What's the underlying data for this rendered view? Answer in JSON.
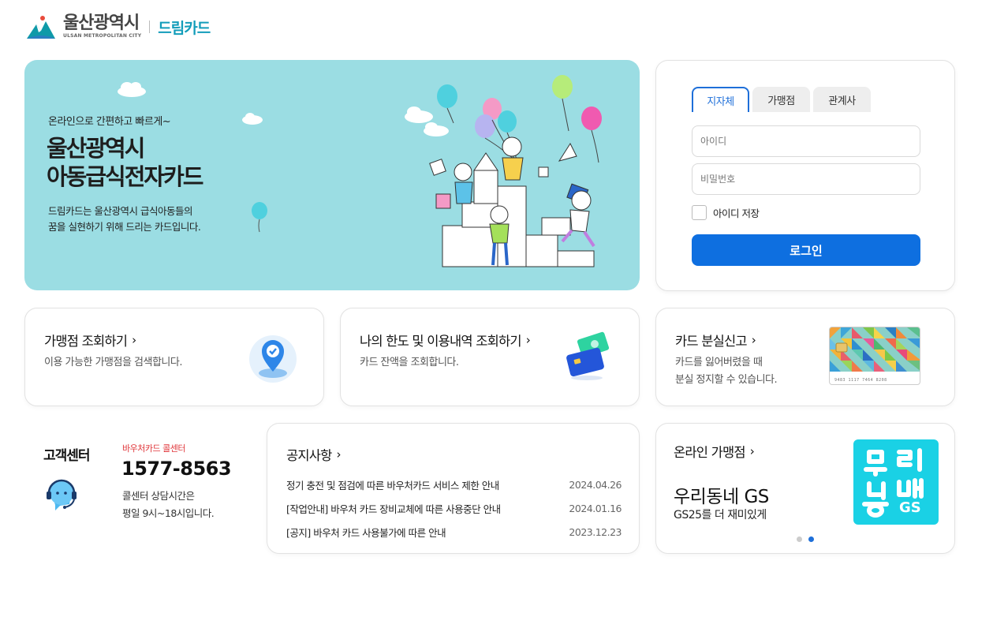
{
  "header": {
    "logo_main": "울산광역시",
    "logo_sub": "ULSAN METROPOLITAN CITY",
    "brand": "드림카드"
  },
  "hero": {
    "subtitle": "온라인으로 간편하고 빠르게~",
    "title_line1": "울산광역시",
    "title_line2": "아동급식전자카드",
    "desc_line1": "드림카드는 울산광역시 급식아동들의",
    "desc_line2": "꿈을 실현하기 위해 드리는 카드입니다."
  },
  "login": {
    "tabs": [
      {
        "label": "지자체",
        "active": true
      },
      {
        "label": "가맹점",
        "active": false
      },
      {
        "label": "관계사",
        "active": false
      }
    ],
    "id_placeholder": "아이디",
    "pw_placeholder": "비밀번호",
    "remember_label": "아이디 저장",
    "remember_checked": false,
    "button_label": "로그인"
  },
  "quick": [
    {
      "title": "가맹점 조회하기",
      "desc1": "이용 가능한 가맹점을 검색합니다.",
      "desc2": "",
      "icon": "location-pin-icon"
    },
    {
      "title": "나의 한도 및 이용내역 조회하기",
      "desc1": "카드 잔액을 조회합니다.",
      "desc2": "",
      "icon": "card-money-icon"
    },
    {
      "title": "카드 분실신고",
      "desc1": "카드를 잃어버렸을 때",
      "desc2": "분실 정지할 수 있습니다.",
      "icon": "card-image",
      "card_number": "9483 1117 7464 8208"
    }
  ],
  "customer_center": {
    "title": "고객센터",
    "sub_label": "바우처카드 콜센터",
    "phone": "1577-8563",
    "hours_line1": "콜센터 상담시간은",
    "hours_line2": "평일 9시~18시입니다."
  },
  "notice": {
    "title": "공지사항",
    "items": [
      {
        "title": "정기 충전 및 점검에 따른 바우처카드 서비스 제한 안내",
        "date": "2024.04.26"
      },
      {
        "title": "[작업안내] 바우처 카드 장비교체에 따른 사용중단 안내",
        "date": "2024.01.16"
      },
      {
        "title": "[공지] 바우처 카드 사용불가에 따른 안내",
        "date": "2023.12.23"
      }
    ]
  },
  "online": {
    "title": "온라인 가맹점",
    "name": "우리동네 GS",
    "tagline": "GS25를 더 재미있게",
    "logo_text": "우리동네GS",
    "slides": 2,
    "active_slide": 2
  },
  "colors": {
    "brand": "#139dba",
    "primary": "#0e6fe0",
    "hero_bg": "#9bdde3",
    "accent_red": "#e0363a",
    "gs_box": "#1ad1e5"
  }
}
